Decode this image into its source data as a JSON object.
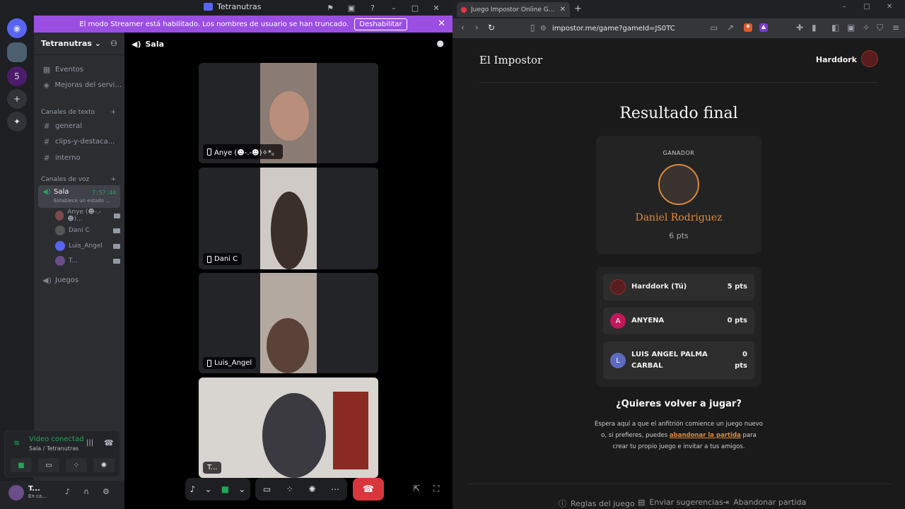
{
  "discord": {
    "window_title": "Tetranutras",
    "streamer_banner": {
      "text": "El modo Streamer está habilitado. Los nombres de usuario se han truncado.",
      "button": "Deshabilitar"
    },
    "server_name": "Tetranutras",
    "nav_items": [
      "Eventos",
      "Mejoras del servi..."
    ],
    "text_category": "Canales de texto",
    "text_channels": [
      "general",
      "clips-y-destaca...",
      "interno"
    ],
    "voice_category": "Canales de voz",
    "voice_channel": {
      "name": "Sala",
      "time": "7:57:44",
      "status": "Establece un estado ..."
    },
    "voice_users": [
      "Anye (☻-.-☻)...",
      "Dani C",
      "Luis_Angel",
      "T..."
    ],
    "games_channel": "Juegos",
    "stage_title": "Sala",
    "tiles": [
      {
        "label": "Anye (☻-.-☻)✧*。"
      },
      {
        "label": "Dani C"
      },
      {
        "label": "Luis_Angel"
      },
      {
        "label": "T..."
      }
    ],
    "voice_panel": {
      "status": "Vídeo conectad",
      "location": "Sala / Tetranutras"
    },
    "user": {
      "name": "T...",
      "status": "En ca..."
    }
  },
  "browser": {
    "tab_title": "Juego Impostor Online Gratis - J",
    "url": "impostor.me/game?gameId=JS0TC",
    "site": {
      "title": "El Impostor",
      "user": "Harddork",
      "heading": "Resultado final",
      "winner_label": "GANADOR",
      "winner_name": "Daniel Rodriguez",
      "winner_points": "6 pts",
      "leaderboard": [
        {
          "initial": "",
          "name": "Harddork (Tú)",
          "points": "5 pts",
          "color": "#5a1d1d"
        },
        {
          "initial": "A",
          "name": "ANYENA",
          "points": "0 pts",
          "color": "#c2185b"
        },
        {
          "initial": "L",
          "name": "LUIS ANGEL PALMA CARBAL",
          "points": "0 pts",
          "color": "#5c6bc0"
        }
      ],
      "play_again_title": "¿Quieres volver a jugar?",
      "play_again_text_1": "Espera aquí a que el anfitrión comience un juego nuevo o, si prefieres, puedes",
      "play_again_link": "abandonar la partida",
      "play_again_text_2": "para crear tu propio juego e invitar a tus amigos.",
      "footer": [
        "Reglas del juego",
        "Enviar sugerencias",
        "Abandonar partida"
      ]
    }
  }
}
